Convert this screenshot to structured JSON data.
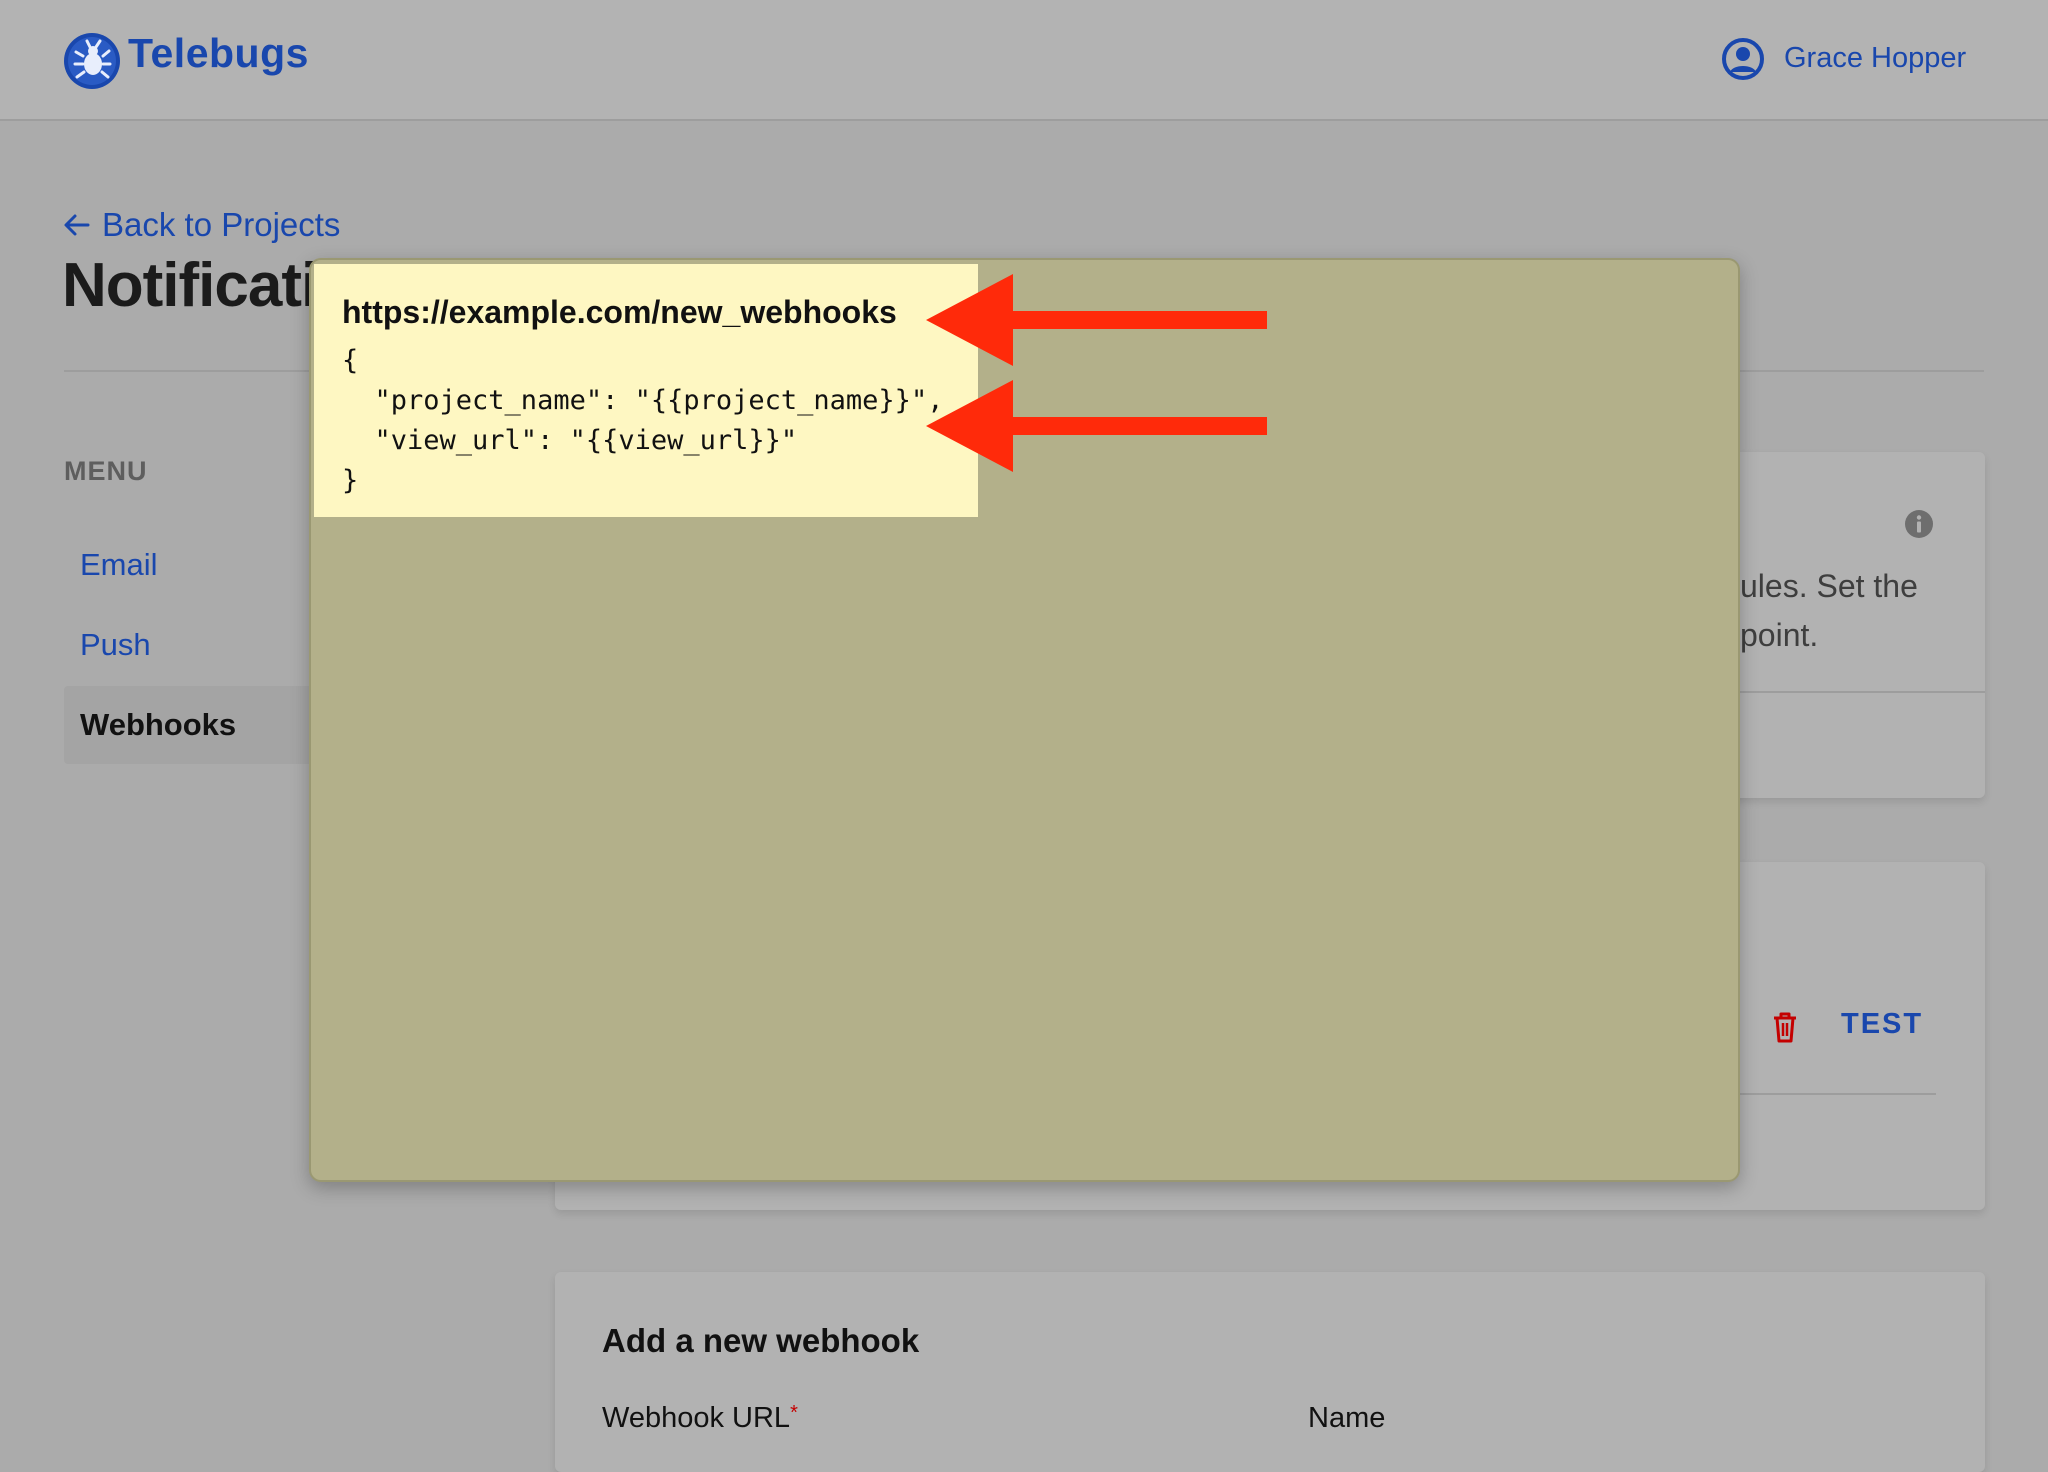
{
  "app": {
    "name": "Telebugs"
  },
  "user": {
    "name": "Grace Hopper"
  },
  "nav": {
    "back_label": "Back to Projects"
  },
  "page": {
    "title": "Notificati"
  },
  "menu": {
    "heading": "MENU",
    "items": [
      {
        "label": "Email",
        "active": false
      },
      {
        "label": "Push",
        "active": false
      },
      {
        "label": "Webhooks",
        "active": true
      }
    ]
  },
  "webhooks_card": {
    "description_line1": "ules. Set the",
    "description_line2": "point."
  },
  "webhook_list": {
    "test_label": "TEST"
  },
  "add_webhook": {
    "title": "Add a new webhook",
    "url_label": "Webhook URL",
    "required_mark": "*",
    "name_label": "Name"
  },
  "annotation": {
    "url": "https://example.com/new_webhooks",
    "code_lines": [
      "{",
      "  \"project_name\": \"{{project_name}}\",",
      "  \"view_url\": \"{{view_url}}\"",
      "}"
    ],
    "arrow_color": "#ff2a0a"
  },
  "colors": {
    "brand": "#1947ad",
    "note_background": "#fef7c2",
    "popup_background": "#b3b08a",
    "danger": "#c40000"
  }
}
